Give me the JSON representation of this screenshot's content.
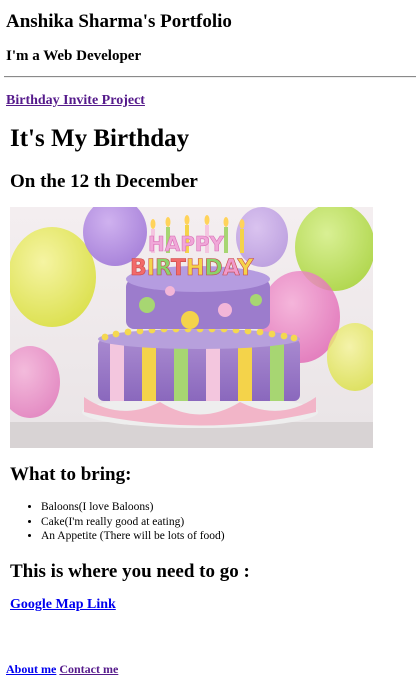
{
  "header": {
    "title": "Anshika Sharma's Portfolio",
    "subtitle": "I'm a Web Developer"
  },
  "project_link": {
    "label": "Birthday Invite Project"
  },
  "invite": {
    "heading": "It's My Birthday",
    "date": "On the 12 th December",
    "image": {
      "alt": "birthday cake",
      "banner_text": "HAPPY BIRTHDAY"
    },
    "bring_heading": "What to bring:",
    "bring_items": [
      "Baloons(I love Baloons)",
      "Cake(I'm really good at eating)",
      "An Appetite (There will be lots of food)"
    ],
    "directions_heading": "This is where you need to go :",
    "map_link": "Google Map Link"
  },
  "footer": {
    "about": "About me",
    "contact": "Contact me"
  },
  "colors": {
    "link_unvisited": "#0000ee",
    "link_visited": "#551a8b"
  }
}
